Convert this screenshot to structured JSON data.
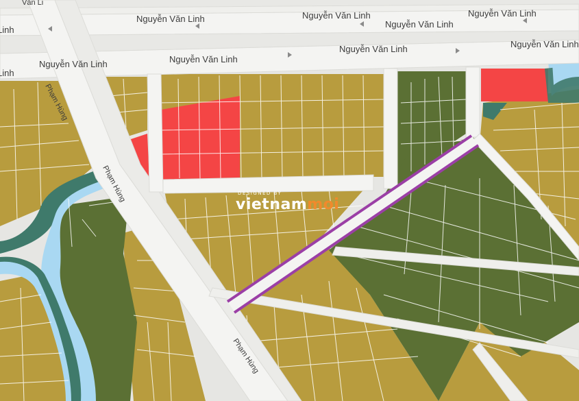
{
  "map": {
    "colors": {
      "background": "#e6e6e3",
      "residential_land": "#b89c3e",
      "green_land": "#5b7034",
      "red_land": "#f44545",
      "river_water": "#a9d8f2",
      "river_bank": "#3f7a6b",
      "road": "#f4f4f2",
      "parcel_line": "#ffffff",
      "planned_road": "#9b3fa6"
    },
    "streets": {
      "nguyen_van_linh": "Nguyễn Văn Linh",
      "pham_hung": "Phạm Hùng",
      "cut_left": "Linh",
      "cut_top": "Văn Li"
    },
    "watermark": {
      "designed_by": "DESIGNED BY",
      "brand_main": "vietnam",
      "brand_accent": "moi",
      "main_color": "#ffffff",
      "accent_color": "#f08a2c"
    },
    "planned_road_label": "planned-road-overlay"
  }
}
